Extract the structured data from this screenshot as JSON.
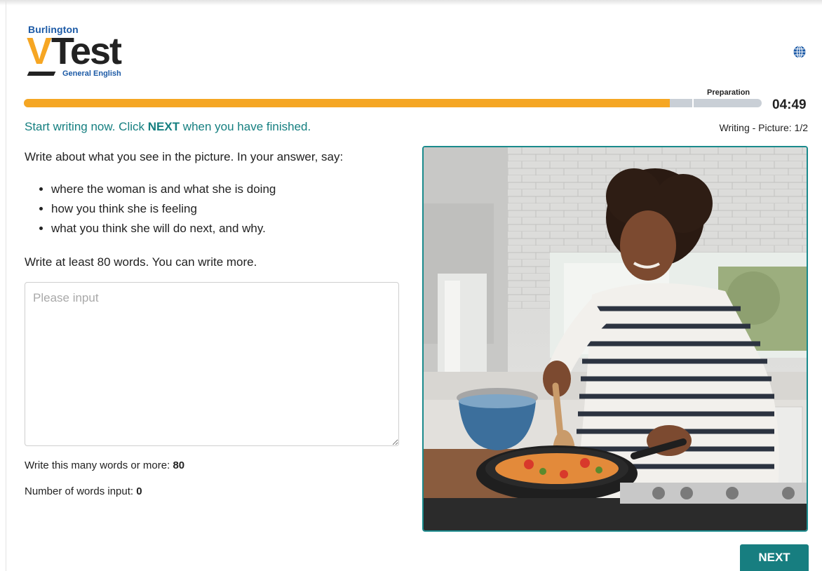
{
  "header": {
    "brand": "Burlington",
    "logo_v": "V",
    "logo_test": "Test",
    "logo_sub": "General English",
    "globe_icon": "globe-icon"
  },
  "progress": {
    "label": "Preparation",
    "timer": "04:49",
    "fill_fraction": 0.875,
    "segment_break_fraction": 0.906,
    "fill_color": "#f5a623",
    "track_color": "#c9cfd6"
  },
  "task": {
    "instruction_before": "Start writing now. Click ",
    "instruction_bold": "NEXT",
    "instruction_after": " when you have finished.",
    "section": "Writing - Picture: 1/2",
    "prompt": "Write about what you see in the picture. In your answer, say:",
    "bullets": [
      "where the woman is and what she is doing",
      "how you think she is feeling",
      "what you think she will do next, and why."
    ],
    "min_note": "Write at least 80 words. You can write more."
  },
  "answer": {
    "placeholder": "Please input",
    "value": ""
  },
  "stats": {
    "min_words_label": "Write this many words or more: ",
    "min_words": "80",
    "count_label": "Number of words input: ",
    "count": "0"
  },
  "buttons": {
    "next_label": "NEXT"
  },
  "colors": {
    "accent": "#177e80",
    "brand_orange": "#f6a623",
    "brand_blue": "#1c5aa6"
  }
}
